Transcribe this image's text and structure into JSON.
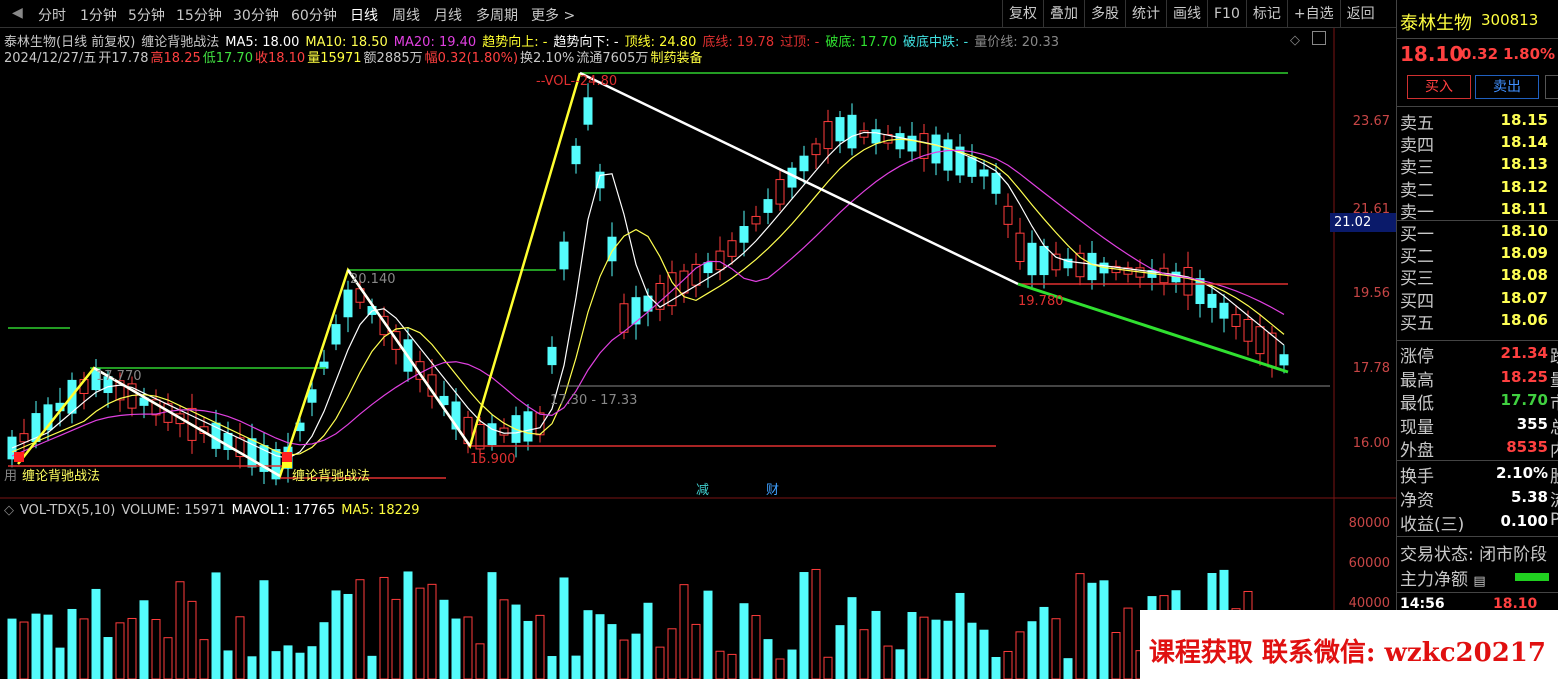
{
  "toolbar": {
    "periods": [
      "分时",
      "1分钟",
      "5分钟",
      "15分钟",
      "30分钟",
      "60分钟",
      "日线",
      "周线",
      "月线",
      "多周期",
      "更多 >"
    ],
    "active_period": "日线",
    "right_buttons": [
      "复权",
      "叠加",
      "多股",
      "统计",
      "画线",
      "F10",
      "标记",
      "+自选",
      "返回"
    ]
  },
  "header": {
    "stock_name": "泰林生物(日线 前复权)",
    "indicator": "缠论背驰战法",
    "ma5": "MA5: 18.00",
    "ma10": "MA10: 18.50",
    "ma20": "MA20: 19.40",
    "trend_up": "趋势向上: -",
    "trend_down": "趋势向下: -",
    "top_line": "顶线: 24.80",
    "bottom_line": "底线: 19.78",
    "over_top": "过顶: -",
    "break_bottom": "破底: 17.70",
    "break_mid": "破底中跌: -",
    "vol_price_line": "量价线: 20.33"
  },
  "quote_line": {
    "date": "2024/12/27/五",
    "open": "开17.78",
    "high": "高18.25",
    "low": "低17.70",
    "close": "收18.10",
    "volume": "量15971",
    "amount": "额2885万",
    "change": "幅0.32(1.80%)",
    "turnover": "换2.10%",
    "float": "流通7605万",
    "sector": "制药装备"
  },
  "chart_labels": {
    "top": "--VOL--24.80",
    "l1": "20.140",
    "l2": "17.770",
    "l3": "15.900",
    "l4": "17.30 - 17.33",
    "l5": "19.780",
    "tag1": "缠论背驰战法",
    "tag2": "缠论背驰战法",
    "tag_prefix": "用",
    "event1": "减",
    "event2": "财"
  },
  "price_axis": [
    "23.67",
    "21.61",
    "19.56",
    "17.78",
    "16.00"
  ],
  "current_price_tag": "21.02",
  "vol_header": {
    "name": "VOL-TDX(5,10)",
    "volume": "VOLUME: 15971",
    "mavol1": "MAVOL1: 17765",
    "ma5": "MA5: 18229"
  },
  "vol_axis": [
    "80000",
    "60000",
    "40000"
  ],
  "side": {
    "name": "泰林生物",
    "code": "300813",
    "price": "18.10",
    "change": "0.32",
    "pct": "1.80%",
    "buy_btn": "买入",
    "sell_btn": "卖出",
    "asks": [
      {
        "label": "卖五",
        "price": "18.15"
      },
      {
        "label": "卖四",
        "price": "18.14"
      },
      {
        "label": "卖三",
        "price": "18.13"
      },
      {
        "label": "卖二",
        "price": "18.12"
      },
      {
        "label": "卖一",
        "price": "18.11"
      }
    ],
    "bids": [
      {
        "label": "买一",
        "price": "18.10"
      },
      {
        "label": "买二",
        "price": "18.09"
      },
      {
        "label": "买三",
        "price": "18.08"
      },
      {
        "label": "买四",
        "price": "18.07"
      },
      {
        "label": "买五",
        "price": "18.06"
      }
    ],
    "stats": [
      {
        "label": "涨停",
        "value": "21.34",
        "extra": "跌",
        "color": "#ff4040"
      },
      {
        "label": "最高",
        "value": "18.25",
        "extra": "量",
        "color": "#ff4040"
      },
      {
        "label": "最低",
        "value": "17.70",
        "extra": "市",
        "color": "#40d040"
      },
      {
        "label": "现量",
        "value": "355",
        "extra": "总",
        "color": "#ffffff"
      },
      {
        "label": "外盘",
        "value": "8535",
        "extra": "内",
        "color": "#ff4040"
      }
    ],
    "stats2": [
      {
        "label": "换手",
        "value": "2.10%",
        "extra": "股"
      },
      {
        "label": "净资",
        "value": "5.38",
        "extra": "流"
      },
      {
        "label": "收益(三)",
        "value": "0.100",
        "extra": "P"
      }
    ],
    "trade_status": "交易状态: 闭市阶段",
    "main_net": "主力净额",
    "time": "14:56",
    "time_price": "18.10"
  },
  "watermark": "课程获取 联系微信: wzkc20217"
}
